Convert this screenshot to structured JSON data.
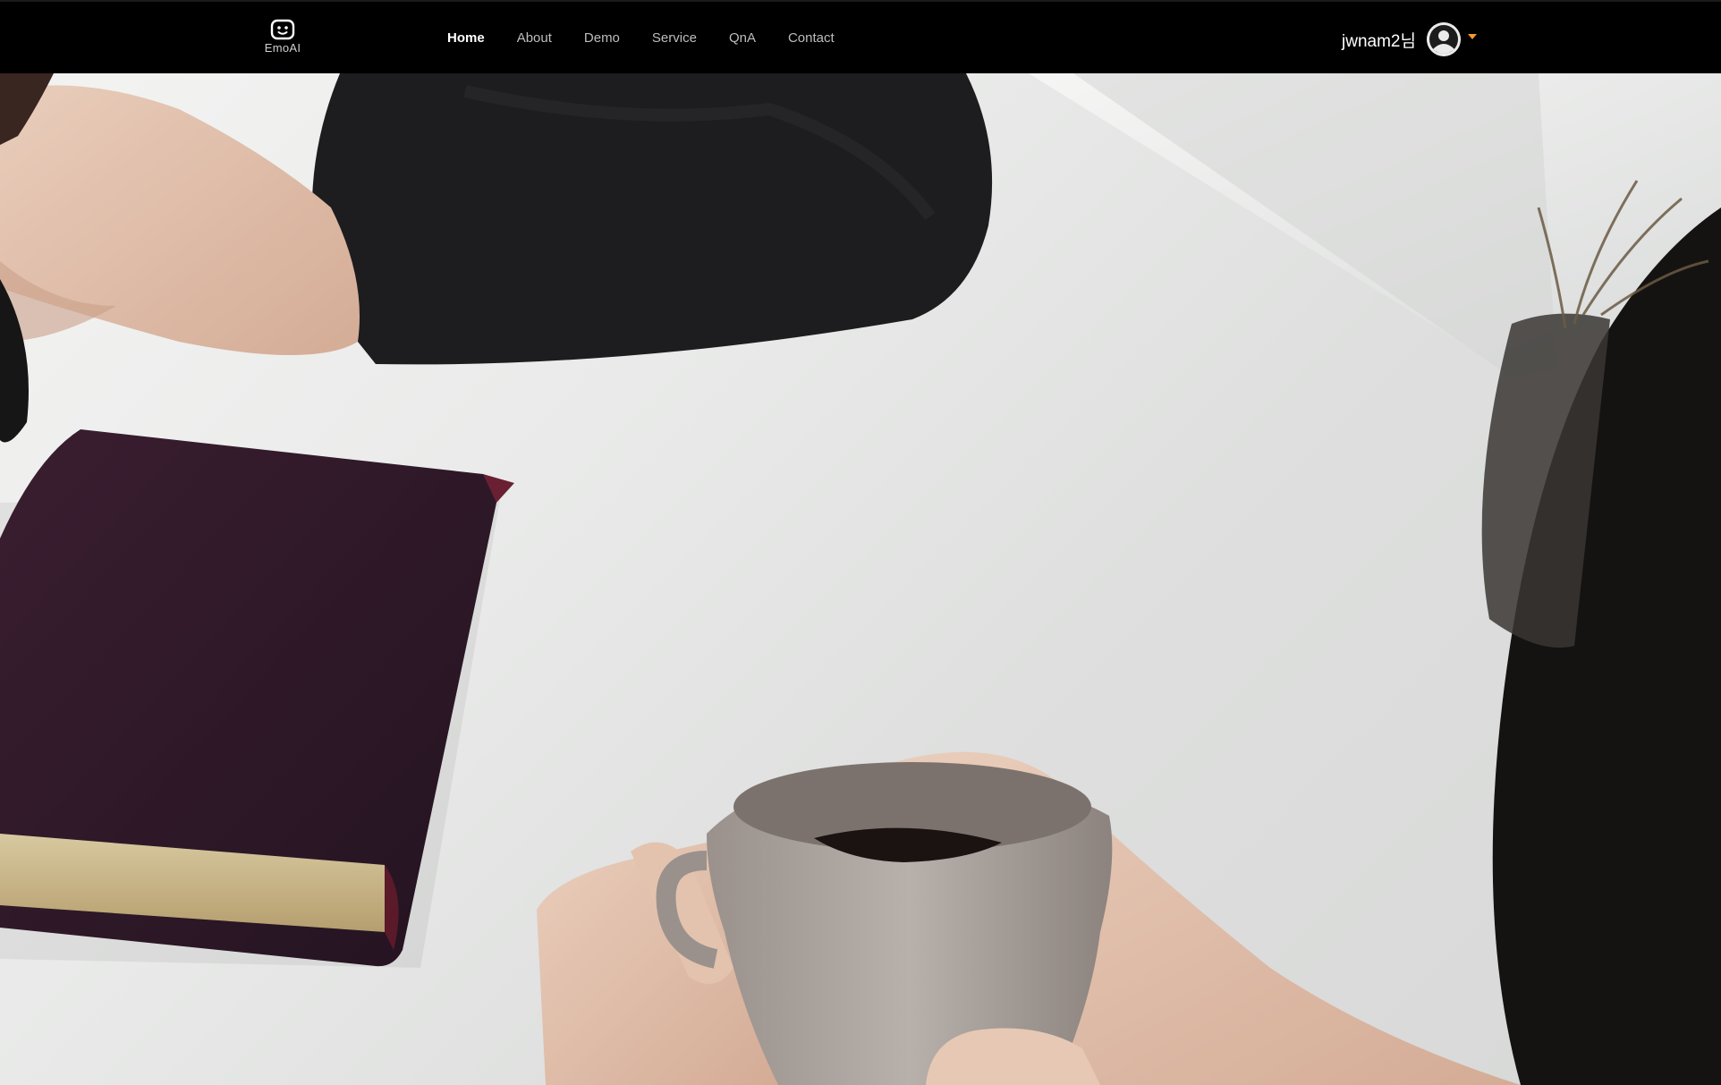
{
  "brand": {
    "name": "EmoAI",
    "icon": "robot-face-icon"
  },
  "nav": {
    "items": [
      {
        "label": "Home",
        "active": true
      },
      {
        "label": "About",
        "active": false
      },
      {
        "label": "Demo",
        "active": false
      },
      {
        "label": "Service",
        "active": false
      },
      {
        "label": "QnA",
        "active": false
      },
      {
        "label": "Contact",
        "active": false
      }
    ]
  },
  "user": {
    "name": "jwnam2님",
    "avatar_icon": "user-avatar-icon",
    "dropdown_icon": "caret-down-icon",
    "caret_color": "#f29a2e"
  },
  "hero": {
    "image_alt": ""
  }
}
